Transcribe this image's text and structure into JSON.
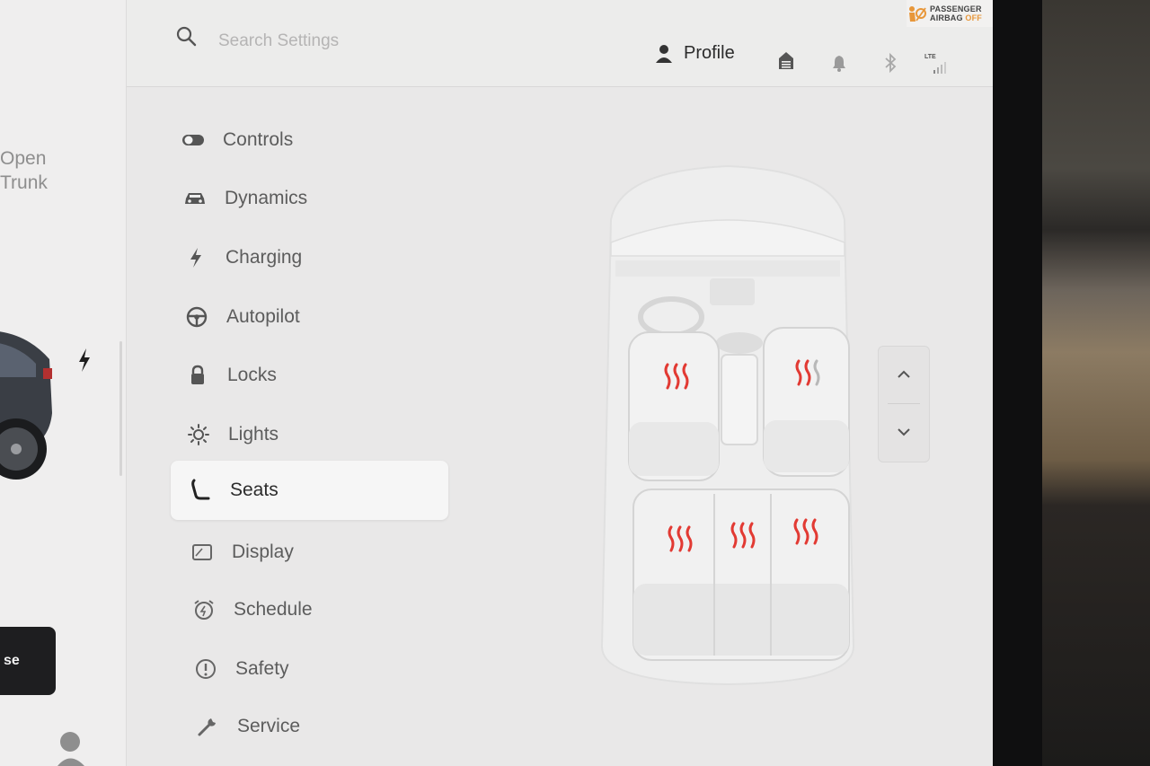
{
  "window": {
    "accent_heat": "#e23a33"
  },
  "car_panel": {
    "trunk_line1": "Open",
    "trunk_line2": "Trunk",
    "park_label": "se"
  },
  "topbar": {
    "search_placeholder": "Search Settings",
    "profile_label": "Profile",
    "airbag_line1": "PASSENGER",
    "airbag_line2": "AIRBAG",
    "airbag_state": "OFF",
    "network_label": "LTE",
    "icons": [
      "search-icon",
      "person-icon",
      "garage-icon",
      "bell-icon",
      "bluetooth-icon",
      "lte-signal-icon"
    ]
  },
  "nav": {
    "items": [
      {
        "label": "Controls",
        "icon": "toggle-icon"
      },
      {
        "label": "Dynamics",
        "icon": "car-icon"
      },
      {
        "label": "Charging",
        "icon": "bolt-icon"
      },
      {
        "label": "Autopilot",
        "icon": "steering-wheel-icon"
      },
      {
        "label": "Locks",
        "icon": "lock-icon"
      },
      {
        "label": "Lights",
        "icon": "sun-icon"
      },
      {
        "label": "Seats",
        "icon": "seat-icon",
        "active": true
      },
      {
        "label": "Display",
        "icon": "display-icon"
      },
      {
        "label": "Schedule",
        "icon": "alarm-clock-icon"
      },
      {
        "label": "Safety",
        "icon": "alert-circle-icon"
      },
      {
        "label": "Service",
        "icon": "wrench-icon"
      }
    ]
  },
  "seats": {
    "heaters": [
      {
        "name": "driver",
        "level": 3
      },
      {
        "name": "passenger",
        "level": 2
      },
      {
        "name": "rear-left",
        "level": 3
      },
      {
        "name": "rear-center",
        "level": 3
      },
      {
        "name": "rear-right",
        "level": 3
      }
    ]
  },
  "scroll": {
    "up": "up",
    "down": "down"
  }
}
